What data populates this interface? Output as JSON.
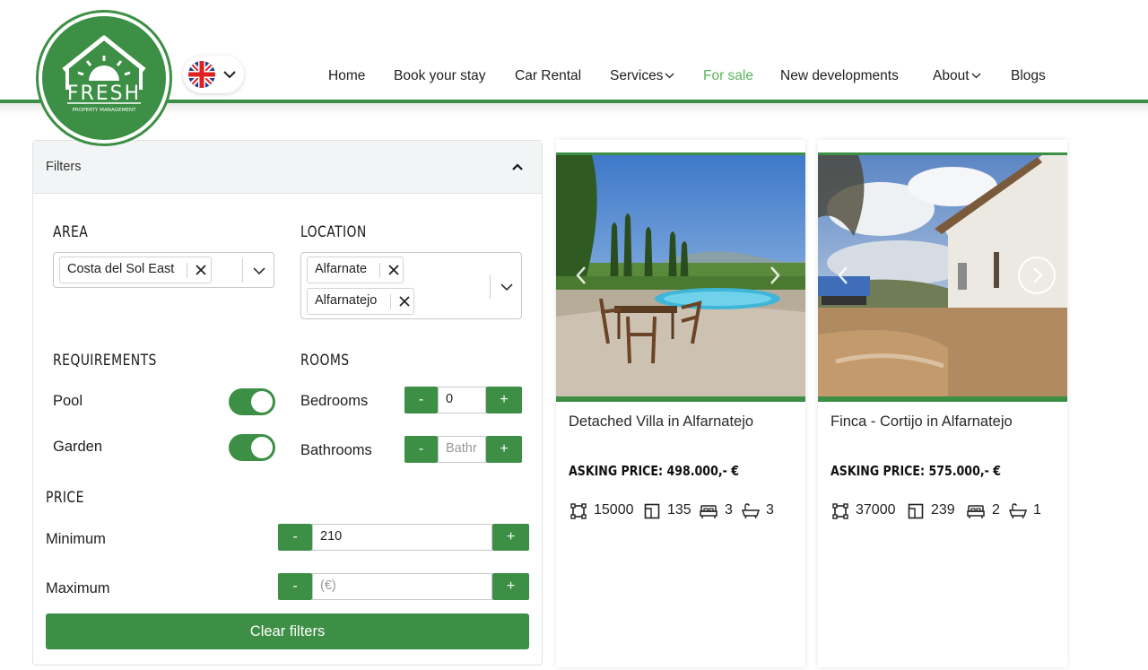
{
  "brand": {
    "logo_word": "FRESH",
    "logo_sub": "PROPERTY MANAGEMENT",
    "primary_color": "#3c8f44",
    "active_color": "#58b65c"
  },
  "language": {
    "flag": "uk-flag-icon"
  },
  "nav": {
    "items": [
      {
        "label": "Home"
      },
      {
        "label": "Book your stay"
      },
      {
        "label": "Car Rental"
      },
      {
        "label": "Services",
        "dropdown": true
      },
      {
        "label": "For sale",
        "active": true
      },
      {
        "label": "New developments"
      },
      {
        "label": "About",
        "dropdown": true
      },
      {
        "label": "Blogs"
      }
    ]
  },
  "filters": {
    "title": "Filters",
    "area": {
      "title": "AREA",
      "selected": [
        "Costa del Sol East"
      ]
    },
    "location": {
      "title": "LOCATION",
      "selected": [
        "Alfarnate",
        "Alfarnatejo"
      ]
    },
    "requirements": {
      "title": "REQUIREMENTS",
      "pool": {
        "label": "Pool",
        "on": true
      },
      "garden": {
        "label": "Garden",
        "on": true
      }
    },
    "rooms": {
      "title": "ROOMS",
      "bedrooms": {
        "label": "Bedrooms",
        "value": "0"
      },
      "bathrooms": {
        "label": "Bathrooms",
        "placeholder": "Bathr"
      }
    },
    "price": {
      "title": "PRICE",
      "minimum": {
        "label": "Minimum",
        "value": "210"
      },
      "maximum": {
        "label": "Maximum",
        "placeholder": "(€)"
      }
    },
    "stepper": {
      "minus": "-",
      "plus": "+"
    },
    "clear_label": "Clear filters"
  },
  "listings": [
    {
      "title": "Detached Villa in Alfarnatejo",
      "price": "ASKING PRICE: 498.000,- €",
      "plot": "15000",
      "built": "135",
      "beds": "3",
      "baths": "3"
    },
    {
      "title": "Finca - Cortijo in Alfarnatejo",
      "price": "ASKING PRICE: 575.000,- €",
      "plot": "37000",
      "built": "239",
      "beds": "2",
      "baths": "1"
    }
  ]
}
